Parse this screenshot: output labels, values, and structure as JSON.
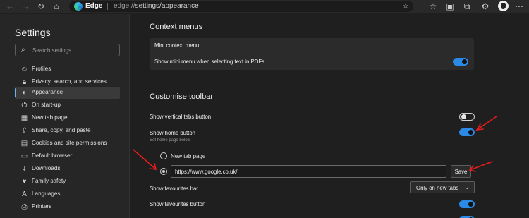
{
  "browser": {
    "brand_label": "Edge",
    "url_scheme": "edge://",
    "url_path": "settings/appearance"
  },
  "sidebar": {
    "title": "Settings",
    "search_placeholder": "Search settings",
    "items": [
      {
        "label": "Profiles",
        "icon": "person-icon"
      },
      {
        "label": "Privacy, search, and services",
        "icon": "lock-icon"
      },
      {
        "label": "Appearance",
        "icon": "palette-icon",
        "active": true
      },
      {
        "label": "On start-up",
        "icon": "power-icon"
      },
      {
        "label": "New tab page",
        "icon": "grid-icon"
      },
      {
        "label": "Share, copy, and paste",
        "icon": "share-icon"
      },
      {
        "label": "Cookies and site permissions",
        "icon": "cookie-icon"
      },
      {
        "label": "Default browser",
        "icon": "browser-icon"
      },
      {
        "label": "Downloads",
        "icon": "download-icon"
      },
      {
        "label": "Family safety",
        "icon": "family-icon"
      },
      {
        "label": "Languages",
        "icon": "language-icon"
      },
      {
        "label": "Printers",
        "icon": "printer-icon"
      }
    ]
  },
  "context_menus": {
    "heading": "Context menus",
    "card_header": "Mini context menu",
    "show_mini_menu_label": "Show mini menu when selecting text in PDFs",
    "show_mini_menu_on": true
  },
  "customise_toolbar": {
    "heading": "Customise toolbar",
    "vertical_tabs_label": "Show vertical tabs button",
    "vertical_tabs_on": false,
    "home_button_label": "Show home button",
    "home_button_sub": "Set home page below",
    "home_button_on": true,
    "radio_new_tab_label": "New tab page",
    "url_value": "https://www.google.co.uk/",
    "save_label": "Save",
    "favourites_bar_label": "Show favourites bar",
    "favourites_bar_value": "Only on new tabs",
    "favourites_button_label": "Show favourites button",
    "favourites_button_on": true
  },
  "colors": {
    "accent": "#2b8ae6",
    "annotation_arrow": "#e11d1d"
  }
}
